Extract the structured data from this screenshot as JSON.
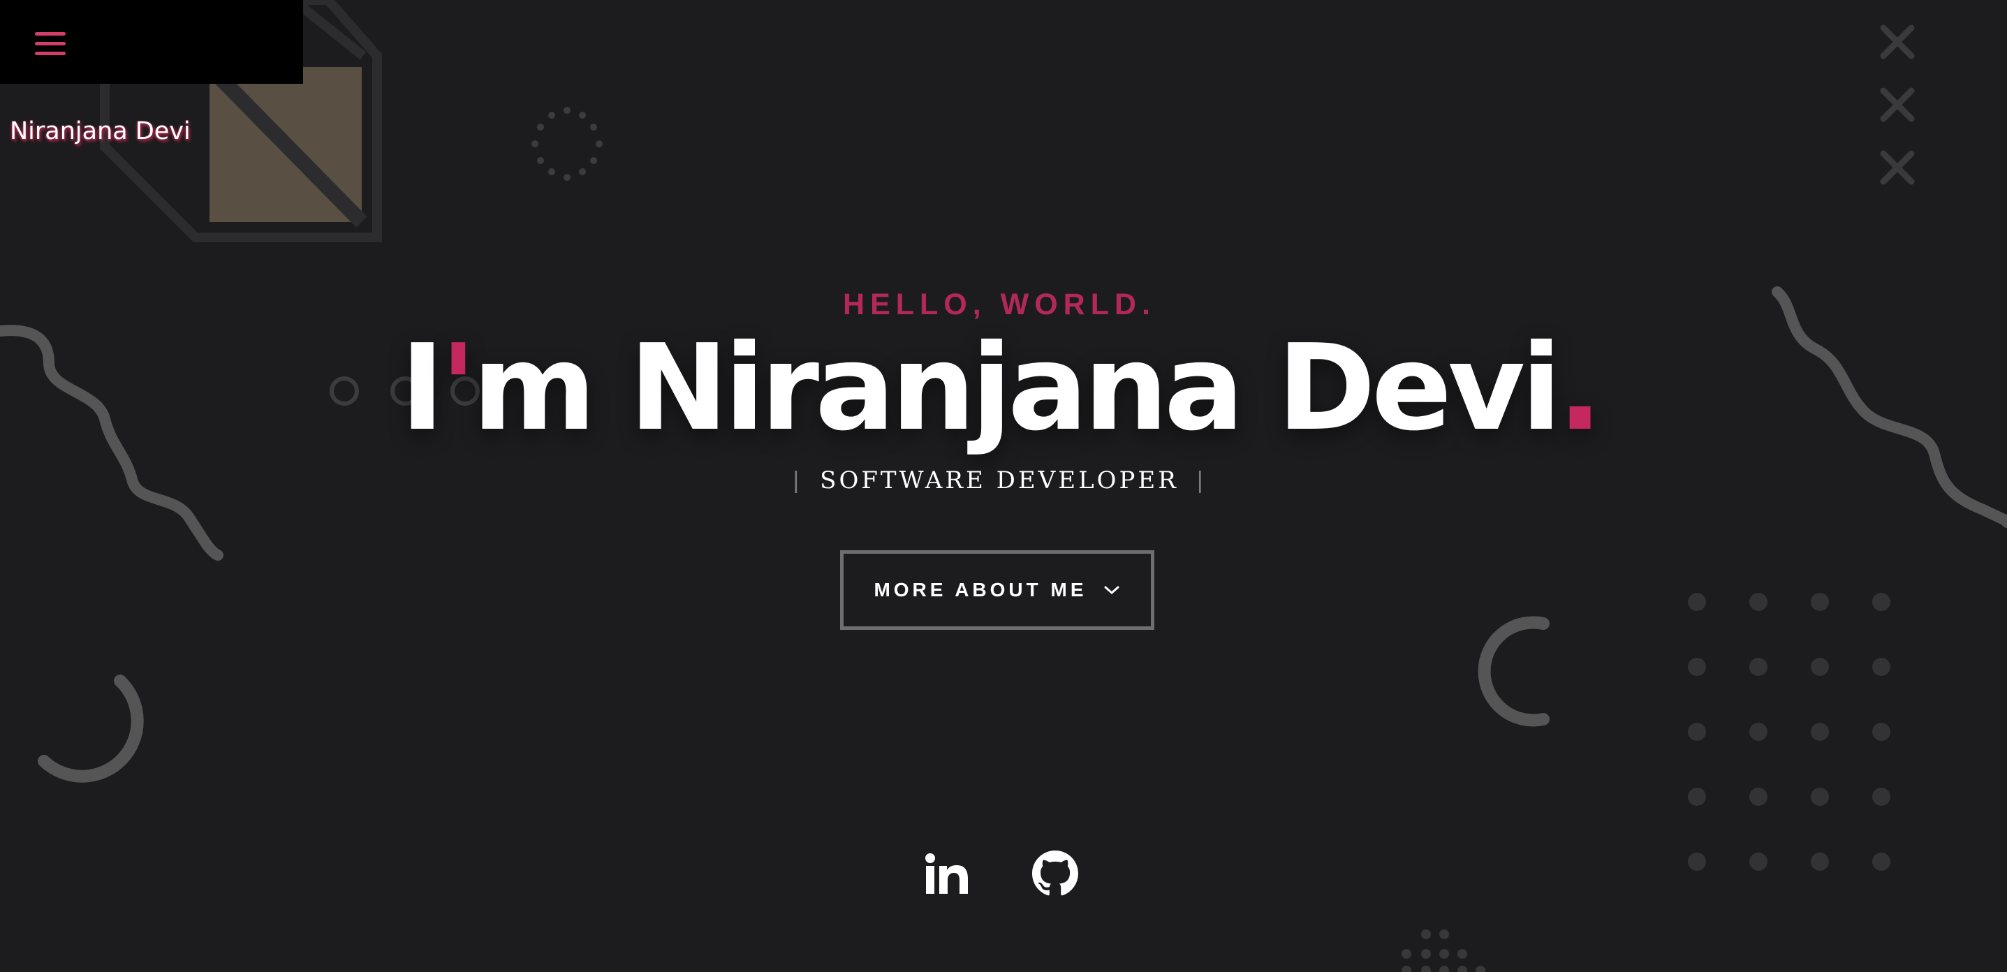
{
  "header": {
    "menu_icon": "hamburger-menu-icon",
    "brand": "Niranjana Devi",
    "accent_color": "#d23f6b"
  },
  "hero": {
    "greeting": "HELLO, WORLD.",
    "headline_start": "I",
    "headline_apostrophe": "'",
    "headline_rest": "m Niranjana Devi",
    "headline_period": ".",
    "role": "SOFTWARE DEVELOPER",
    "role_separator": "|",
    "more_button_label": "MORE ABOUT ME",
    "more_button_icon": "chevron-down-icon",
    "accent_color": "#c4285e"
  },
  "social": {
    "items": [
      {
        "name": "linkedin",
        "icon": "linkedin-icon"
      },
      {
        "name": "github",
        "icon": "github-icon"
      }
    ]
  },
  "colors": {
    "background": "#1c1c1e",
    "decoration": "#4a4a4a"
  }
}
